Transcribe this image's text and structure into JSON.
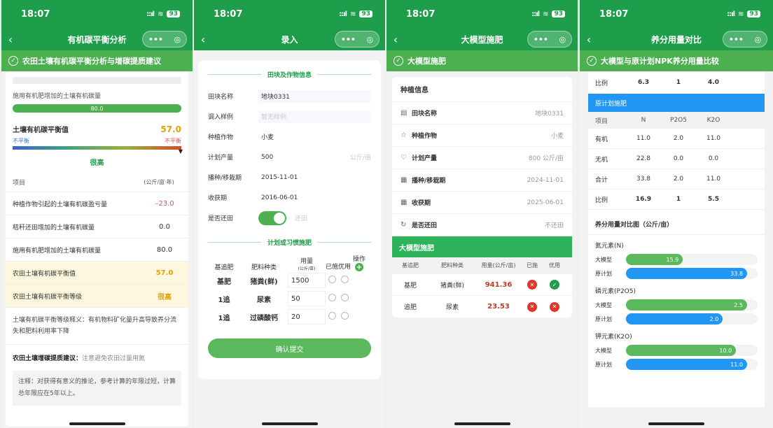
{
  "status": {
    "time": "18:07",
    "battery": "93"
  },
  "colors": {
    "primary": "#1e9e4a",
    "banner": "#4caf50",
    "blue": "#2196f3",
    "amber": "#e6a100",
    "red": "#d93a2b"
  },
  "capsule": {
    "more": "•••",
    "target": "◎"
  },
  "phone1": {
    "title": "有机碳平衡分析",
    "banner": "农田土壤有机碳平衡分析与增碳提质建议",
    "bar_label": "施用有机肥增加的土壤有机碳量",
    "bar_value": "80.0",
    "balance_title": "土壤有机碳平衡值",
    "balance_value": "57.0",
    "scale_left": "不平衡",
    "scale_right": "不平衡",
    "level": "很高",
    "table_head": {
      "item": "项目",
      "unit": "(公斤/亩·年)"
    },
    "rows": [
      {
        "item": "种植作物引起的土壤有机碳盈亏量",
        "value": "–23.0"
      },
      {
        "item": "秸秆还田增加的土壤有机碳量",
        "value": "0.0"
      },
      {
        "item": "施用有机肥增加的土壤有机碳量",
        "value": "80.0"
      },
      {
        "item": "农田土壤有机碳平衡值",
        "value": "57.0"
      },
      {
        "item": "农田土壤有机碳平衡等级",
        "value": "很高"
      }
    ],
    "note_text": "土壤有机碳平衡等级释义：有机物料矿化量升高导致养分流失和肥料利用率下降",
    "advice_label": "农田土壤增碳提质建议：",
    "advice_text": "注意避免农田过量用氮",
    "notice": "注释：对获得有意义的推论，参考计算的年限过短，计算总年限应在5年以上。"
  },
  "phone2": {
    "title": "录入",
    "section1": "田块及作物信息",
    "fields": [
      {
        "label": "田块名称",
        "value": "地块0331",
        "placeholder": false,
        "unit": ""
      },
      {
        "label": "调入样例",
        "value": "暂无样例",
        "placeholder": true,
        "unit": ""
      },
      {
        "label": "种植作物",
        "value": "小麦",
        "placeholder": false,
        "unit": ""
      },
      {
        "label": "计划产量",
        "value": "500",
        "placeholder": false,
        "unit": "公斤/亩"
      },
      {
        "label": "播种/移栽期",
        "value": "2015-11-01",
        "placeholder": false,
        "unit": ""
      },
      {
        "label": "收获期",
        "value": "2016-06-01",
        "placeholder": false,
        "unit": ""
      }
    ],
    "straw": {
      "label": "是否还田",
      "text": "还田"
    },
    "section2": "计划或习惯施肥",
    "head": {
      "base": "基追肥",
      "type": "肥料种类",
      "amount": "用量",
      "amount_unit": "(公斤/亩)",
      "applied": "已施",
      "prefer": "优用",
      "op": "操作"
    },
    "records": [
      {
        "base": "基肥",
        "type": "猪粪(鲜)",
        "amount": "1500"
      },
      {
        "base": "1追",
        "type": "尿素",
        "amount": "50"
      },
      {
        "base": "1追",
        "type": "过磷酸钙",
        "amount": "20"
      }
    ],
    "submit": "确认提交"
  },
  "phone3": {
    "title": "大模型施肥",
    "banner": "大模型施肥",
    "section": "种植信息",
    "info": [
      {
        "icon": "document-icon",
        "glyph": "▤",
        "label": "田块名称",
        "value": "地块0331"
      },
      {
        "icon": "star-icon",
        "glyph": "☆",
        "label": "种植作物",
        "value": "小麦"
      },
      {
        "icon": "heart-icon",
        "glyph": "♡",
        "label": "计划产量",
        "value": "800 公斤/亩"
      },
      {
        "icon": "calendar-icon",
        "glyph": "▦",
        "label": "播种/移栽期",
        "value": "2024-11-01"
      },
      {
        "icon": "calendar-icon",
        "glyph": "▦",
        "label": "收获期",
        "value": "2025-06-01"
      },
      {
        "icon": "refresh-icon",
        "glyph": "↻",
        "label": "是否还田",
        "value": "不还田"
      }
    ],
    "fert_title": "大模型施肥",
    "head": {
      "base": "基追肥",
      "type": "肥料种类",
      "amount": "用量(公斤/亩)",
      "applied": "已施",
      "prefer": "优用"
    },
    "rows": [
      {
        "base": "基肥",
        "type": "猪粪(鲜)",
        "amount": "941.36",
        "prefer_ok": true
      },
      {
        "base": "追肥",
        "type": "尿素",
        "amount": "23.53",
        "prefer_ok": false
      }
    ]
  },
  "phone4": {
    "title": "养分用量对比",
    "banner": "大模型与原计划NPK养分用量比较",
    "top_ratio": {
      "item": "比例",
      "n": "6.3",
      "p": "1",
      "k": "4.0"
    },
    "plan_title": "原计划施肥",
    "head": {
      "item": "项目",
      "n": "N",
      "p": "P2O5",
      "k": "K2O"
    },
    "rows": [
      {
        "item": "有机",
        "n": "11.0",
        "p": "2.0",
        "k": "11.0"
      },
      {
        "item": "无机",
        "n": "22.8",
        "p": "0.0",
        "k": "0.0"
      },
      {
        "item": "合计",
        "n": "33.8",
        "p": "2.0",
        "k": "11.0"
      },
      {
        "item": "比例",
        "n": "16.9",
        "p": "1",
        "k": "5.5"
      }
    ],
    "chart_title": "养分用量对比图（公斤/亩）",
    "series_labels": {
      "model": "大模型",
      "plan": "原计划"
    }
  },
  "chart_data": {
    "type": "bar",
    "title": "养分用量对比图（公斤/亩）",
    "groups": [
      {
        "name": "氮元素(N)",
        "model": 15.9,
        "plan": 33.8
      },
      {
        "name": "磷元素(P2O5)",
        "model": 2.5,
        "plan": 2.0
      },
      {
        "name": "钾元素(K2O)",
        "model": 10.0,
        "plan": 11.0
      }
    ],
    "series": [
      {
        "name": "大模型",
        "color": "#5cb85c"
      },
      {
        "name": "原计划",
        "color": "#2196f3"
      }
    ]
  }
}
